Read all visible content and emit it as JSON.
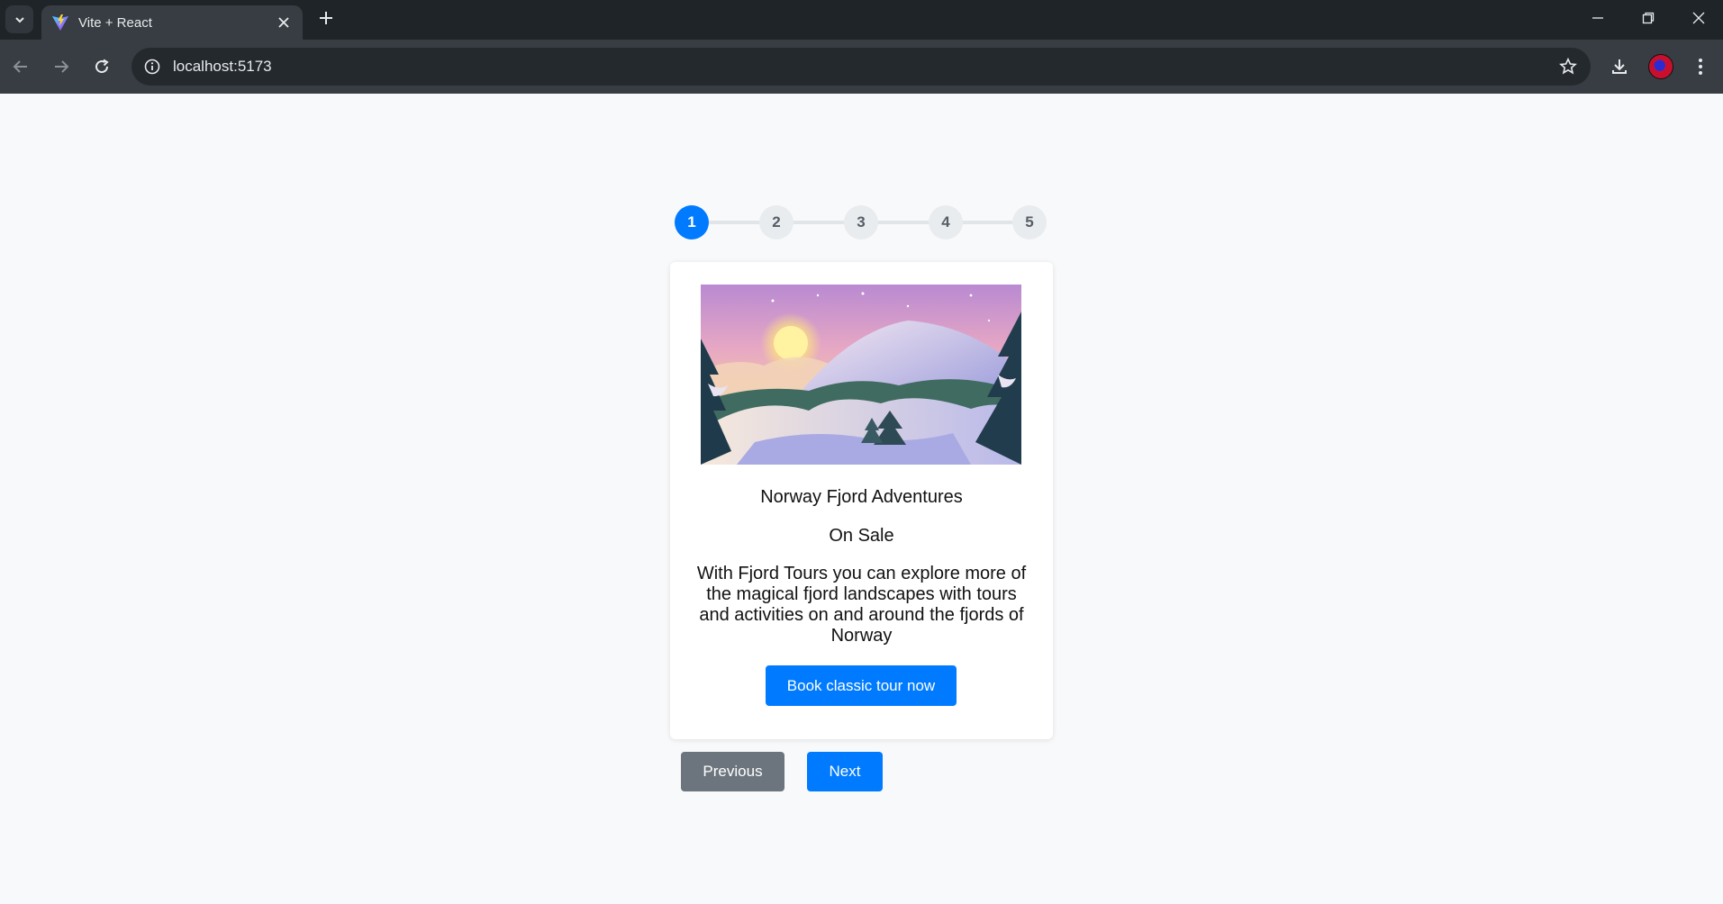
{
  "browser": {
    "tab_title": "Vite + React",
    "url": "localhost:5173",
    "colors": {
      "tabstrip": "#1f2428",
      "toolbar": "#373d42",
      "omnibox": "#24292e"
    }
  },
  "stepper": {
    "steps": [
      "1",
      "2",
      "3",
      "4",
      "5"
    ],
    "active_step": 1,
    "active_color": "#007bff"
  },
  "card": {
    "title": "Norway Fjord Adventures",
    "status": "On Sale",
    "description": "With Fjord Tours you can explore more of the magical fjord landscapes with tours and activities on and around the fjords of Norway",
    "cta_label": "Book classic tour now"
  },
  "navigation": {
    "previous_label": "Previous",
    "next_label": "Next"
  }
}
